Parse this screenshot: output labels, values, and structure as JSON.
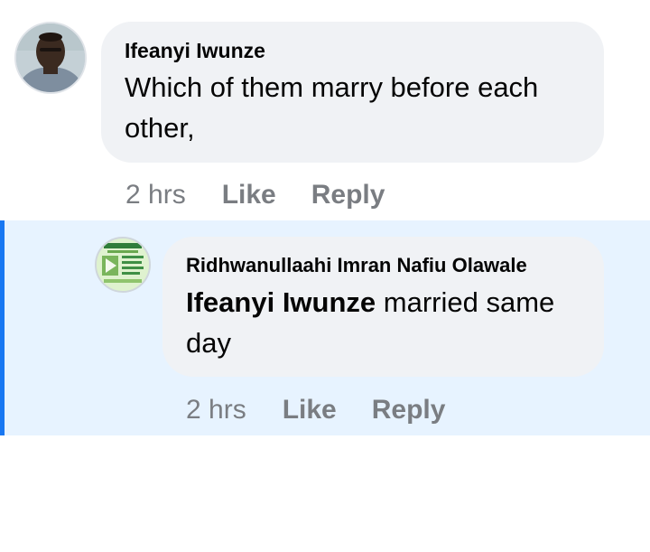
{
  "comment": {
    "author": "Ifeanyi Iwunze",
    "text": "Which of them marry before each other,",
    "time": "2 hrs",
    "like_label": "Like",
    "reply_label": "Reply"
  },
  "reply": {
    "author": "Ridhwanullaahi Imran Nafiu Olawale",
    "mention": "Ifeanyi Iwunze",
    "text": " married same day",
    "time": "2 hrs",
    "like_label": "Like",
    "reply_label": "Reply"
  },
  "colors": {
    "bubble": "#f0f2f5",
    "reply_highlight": "#e7f3ff",
    "accent_bar": "#1877f2",
    "secondary_text": "#65676b"
  }
}
